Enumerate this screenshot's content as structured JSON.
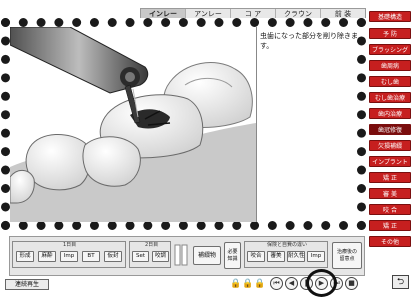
{
  "tabs": [
    "インレー",
    "アンレー",
    "コ ア",
    "クラウン",
    "前 装"
  ],
  "description": "虫歯になった部分を削り除きます。",
  "sidebar": [
    "基礎構造",
    "予 防",
    "ブラッシング",
    "歯周病",
    "むし歯",
    "むし歯治療",
    "歯内治療",
    "歯冠修復",
    "欠損補綴",
    "インプラント",
    "矯 正",
    "審 美",
    "咬 合",
    "矯 正",
    "その他"
  ],
  "bottom": {
    "group1_title": "1日目",
    "group1": [
      "形成",
      "麻酔",
      "Imp",
      "BT",
      "仮封"
    ],
    "group2_title": "2日目",
    "group2": [
      "Set",
      "咬調"
    ],
    "hokan_btn": "補綴物",
    "group3_title": "保険と自費の違い",
    "left_tall_btn": "必要\n知識",
    "group3": [
      "咬合",
      "審美",
      "耐久性",
      "Imp"
    ],
    "right_tall_btn": "治療後の\n留意点"
  },
  "footer": {
    "saigo_label": "連続再生",
    "exit_label": "⮌"
  }
}
